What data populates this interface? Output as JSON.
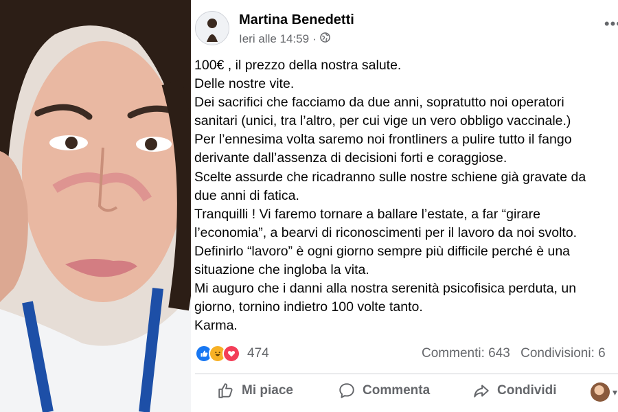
{
  "post": {
    "author": "Martina Benedetti",
    "timestamp": "Ieri alle 14:59",
    "separator": "·",
    "audience_icon": "globe-icon",
    "more_label": "•••",
    "lines": [
      "100€ , il prezzo della nostra salute.",
      "Delle nostre vite.",
      "Dei sacrifici che facciamo da due anni, sopratutto noi operatori",
      "sanitari (unici, tra l’altro,  per cui vige un vero obbligo vaccinale.)",
      "Per l’ennesima volta saremo noi frontliners a pulire tutto il fango",
      "derivante dall’assenza di decisioni forti e coraggiose.",
      "Scelte assurde che ricadranno sulle nostre schiene già gravate da",
      "due anni di fatica.",
      "Tranquilli ! Vi faremo tornare a ballare l’estate, a far “girare",
      "l’economia”, a bearvi di riconoscimenti per il lavoro da noi svolto.",
      "Definirlo “lavoro” è ogni giorno sempre più difficile perché è una",
      "situazione che ingloba la vita.",
      "Mi auguro che i danni alla nostra serenità psicofisica perduta, un",
      "giorno, tornino indietro 100 volte tanto.",
      "Karma."
    ]
  },
  "engagement": {
    "reactions": [
      "like-reaction-icon",
      "haha-reaction-icon",
      "love-reaction-icon"
    ],
    "reaction_count": "474",
    "comments": "Commenti: 643",
    "shares": "Condivisioni: 6"
  },
  "actions": {
    "like": "Mi piace",
    "comment": "Commenta",
    "share": "Condividi"
  },
  "colors": {
    "text": "#050505",
    "secondary": "#65676b",
    "like_blue": "#1877f2",
    "love_red": "#f33e58",
    "haha_yellow": "#f7b125",
    "divider": "#ced0d4"
  }
}
